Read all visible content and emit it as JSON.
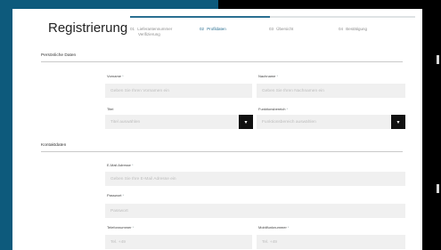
{
  "page": {
    "title": "Registrierung"
  },
  "steps": [
    {
      "number": "01",
      "label_line1": "Lieferantennummer",
      "label_line2": "Verifizierung",
      "active": false
    },
    {
      "number": "02",
      "label_line1": "Profildaten",
      "label_line2": "",
      "active": true
    },
    {
      "number": "03",
      "label_line1": "Übersicht",
      "label_line2": "",
      "active": false
    },
    {
      "number": "04",
      "label_line1": "Bestätigung",
      "label_line2": "",
      "active": false
    }
  ],
  "progress": {
    "active_fraction": 0.49
  },
  "sections": {
    "personal": "Persönliche Daten",
    "contact": "Kontaktdaten"
  },
  "fields": {
    "firstname": {
      "label": "Vorname",
      "required_mark": "*",
      "placeholder": "Geben Sie Ihren Vornamen ein"
    },
    "lastname": {
      "label": "Nachname",
      "required_mark": "*",
      "placeholder": "Geben Sie Ihren Nachnamen ein"
    },
    "title": {
      "label": "Titel",
      "required_mark": "",
      "placeholder": "Titel auswählen",
      "button_icon": "chevron-down-icon",
      "button_glyph": "▾"
    },
    "function": {
      "label": "Funktionsbereich",
      "required_mark": "*",
      "placeholder": "Funktionsbereich auswählen",
      "button_icon": "chevron-down-icon",
      "button_glyph": "▾"
    },
    "email": {
      "label": "E-Mail Adresse",
      "required_mark": "*",
      "placeholder": "Geben Sie Ihre E-Mail Adresse ein"
    },
    "password": {
      "label": "Passwort",
      "required_mark": "*",
      "placeholder": "Passwort"
    },
    "phone": {
      "label": "Telefonnummer",
      "required_mark": "*",
      "placeholder": "Tel. +49"
    },
    "mobile": {
      "label": "Mobilfunknummer",
      "required_mark": "*",
      "placeholder": "Tel. +49"
    }
  },
  "colors": {
    "accent": "#2a6f91",
    "backdrop_blue": "#0d5a7c",
    "input_bg": "#f0f0f0"
  }
}
